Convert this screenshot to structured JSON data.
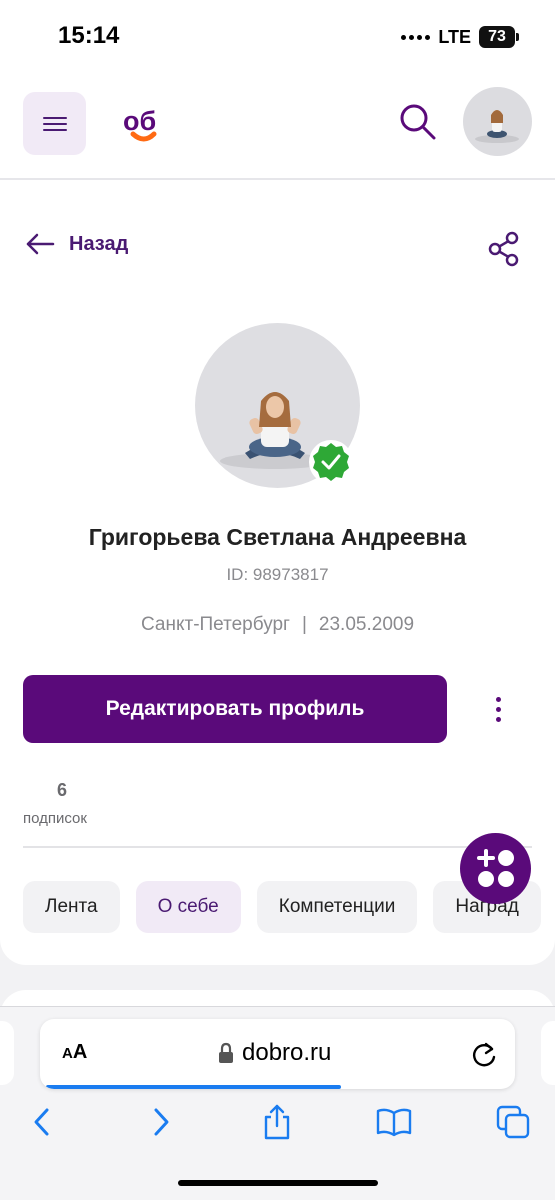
{
  "status_bar": {
    "time": "15:14",
    "network": "LTE",
    "battery": "73"
  },
  "header": {
    "menu_icon": "hamburger-icon",
    "logo_text": "об",
    "search_icon": "search-icon",
    "avatar_icon": "avatar"
  },
  "nav": {
    "back_label": "Назад",
    "share_icon": "share-icon"
  },
  "profile": {
    "name": "Григорьева Светлана Андреевна",
    "id": "ID: 98973817",
    "city": "Санкт-Петербург",
    "separator": "|",
    "birthdate": "23.05.2009",
    "verified_icon": "verified-check-icon"
  },
  "actions": {
    "edit_label": "Редактировать профиль",
    "more_icon": "more-vertical-icon"
  },
  "stats": {
    "subscriptions_count": "6",
    "subscriptions_label": "подписок"
  },
  "tabs": [
    {
      "label": "Лента"
    },
    {
      "label": "О себе"
    },
    {
      "label": "Компетенции"
    },
    {
      "label": "Наград"
    }
  ],
  "browser": {
    "aa_small": "A",
    "aa_big": "A",
    "url": "dobro.ru",
    "loading_progress": 0.62
  },
  "colors": {
    "brand": "#5a0a7a",
    "accent": "#ff6a13",
    "verified": "#2ea836",
    "link": "#1a7cf0"
  }
}
